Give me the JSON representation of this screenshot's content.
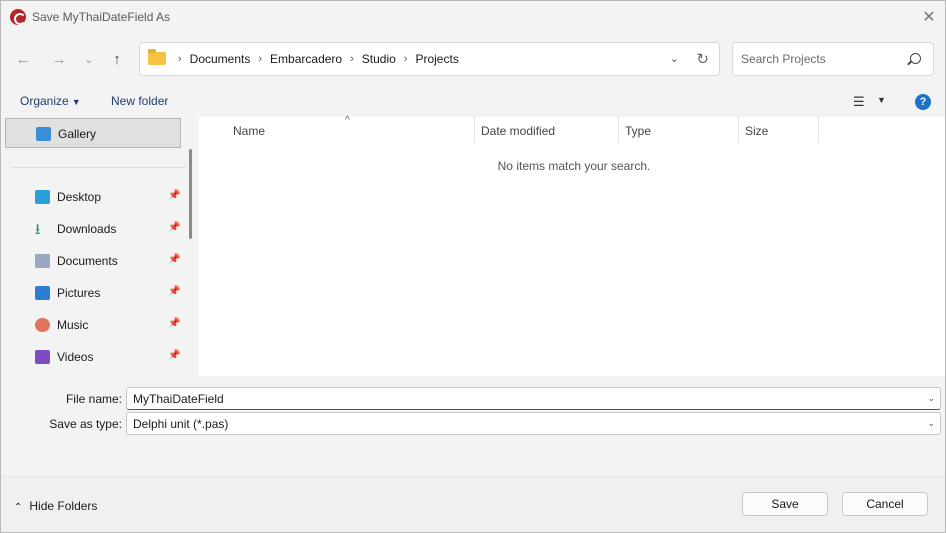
{
  "window": {
    "title": "Save MyThaiDateField As"
  },
  "address": {
    "breadcrumbs": [
      "Documents",
      "Embarcadero",
      "Studio",
      "Projects"
    ],
    "search_placeholder": "Search Projects"
  },
  "toolbar": {
    "organize_label": "Organize",
    "new_folder_label": "New folder",
    "help_label": "?"
  },
  "sidebar": {
    "items": [
      {
        "label": "Gallery",
        "icon": "gallery-icon",
        "pinned": false,
        "selected": true
      },
      {
        "label": "Desktop",
        "icon": "desktop-icon",
        "pinned": true
      },
      {
        "label": "Downloads",
        "icon": "downloads-icon",
        "pinned": true
      },
      {
        "label": "Documents",
        "icon": "documents-icon",
        "pinned": true
      },
      {
        "label": "Pictures",
        "icon": "pictures-icon",
        "pinned": true
      },
      {
        "label": "Music",
        "icon": "music-icon",
        "pinned": true
      },
      {
        "label": "Videos",
        "icon": "videos-icon",
        "pinned": true
      }
    ]
  },
  "file_list": {
    "columns": [
      "Name",
      "Date modified",
      "Type",
      "Size"
    ],
    "empty_message": "No items match your search."
  },
  "form": {
    "file_name_label": "File name:",
    "file_name_value": "MyThaiDateField",
    "save_as_type_label": "Save as type:",
    "save_as_type_value": "Delphi unit (*.pas)"
  },
  "footer": {
    "hide_folders_label": "Hide Folders",
    "save_label": "Save",
    "cancel_label": "Cancel"
  },
  "colors": {
    "accent": "#1a73c9",
    "link_text": "#1f3d6d"
  }
}
